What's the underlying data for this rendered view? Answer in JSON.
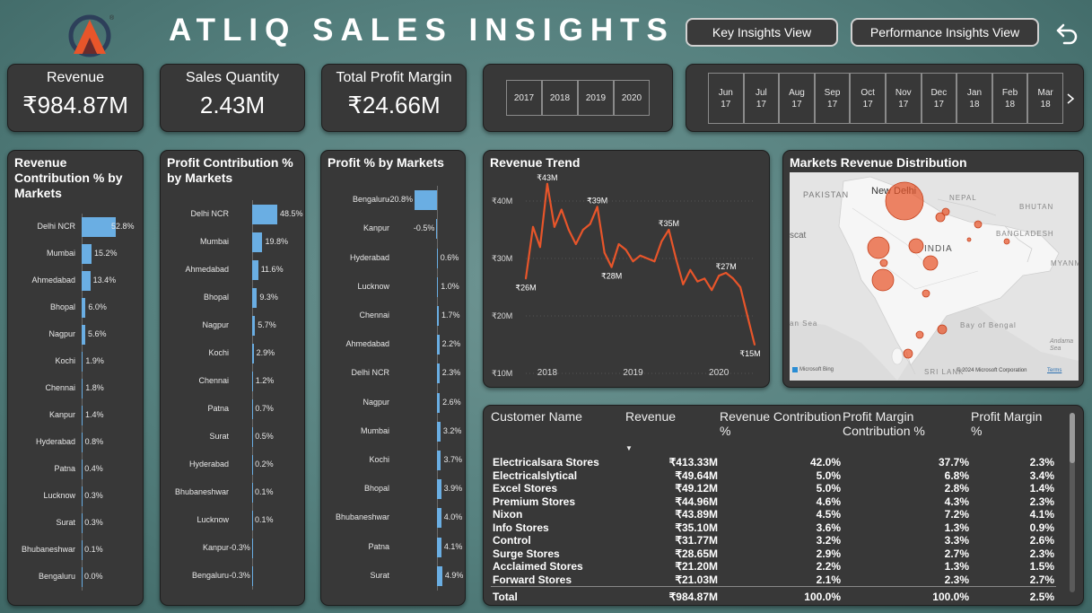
{
  "header": {
    "title": "ATLIQ SALES INSIGHTS",
    "nav_buttons": [
      "Key Insights View",
      "Performance Insights View"
    ]
  },
  "kpis": [
    {
      "label": "Revenue",
      "value": "₹984.87M"
    },
    {
      "label": "Sales Quantity",
      "value": "2.43M"
    },
    {
      "label": "Total Profit Margin",
      "value": "₹24.66M"
    }
  ],
  "year_slicer": [
    "2017",
    "2018",
    "2019",
    "2020"
  ],
  "month_slicer": [
    [
      "Jun",
      "17"
    ],
    [
      "Jul",
      "17"
    ],
    [
      "Aug",
      "17"
    ],
    [
      "Sep",
      "17"
    ],
    [
      "Oct",
      "17"
    ],
    [
      "Nov",
      "17"
    ],
    [
      "Dec",
      "17"
    ],
    [
      "Jan",
      "18"
    ],
    [
      "Feb",
      "18"
    ],
    [
      "Mar",
      "18"
    ]
  ],
  "revenue_contribution": {
    "title": "Revenue Contribution % by Markets",
    "items": [
      {
        "label": "Delhi NCR",
        "value": 52.8,
        "text": "52.8%"
      },
      {
        "label": "Mumbai",
        "value": 15.2,
        "text": "15.2%"
      },
      {
        "label": "Ahmedabad",
        "value": 13.4,
        "text": "13.4%"
      },
      {
        "label": "Bhopal",
        "value": 6.0,
        "text": "6.0%"
      },
      {
        "label": "Nagpur",
        "value": 5.6,
        "text": "5.6%"
      },
      {
        "label": "Kochi",
        "value": 1.9,
        "text": "1.9%"
      },
      {
        "label": "Chennai",
        "value": 1.8,
        "text": "1.8%"
      },
      {
        "label": "Kanpur",
        "value": 1.4,
        "text": "1.4%"
      },
      {
        "label": "Hyderabad",
        "value": 0.8,
        "text": "0.8%"
      },
      {
        "label": "Patna",
        "value": 0.4,
        "text": "0.4%"
      },
      {
        "label": "Lucknow",
        "value": 0.3,
        "text": "0.3%"
      },
      {
        "label": "Surat",
        "value": 0.3,
        "text": "0.3%"
      },
      {
        "label": "Bhubaneshwar",
        "value": 0.1,
        "text": "0.1%"
      },
      {
        "label": "Bengaluru",
        "value": 0.0,
        "text": "0.0%"
      }
    ]
  },
  "profit_contribution": {
    "title": "Profit Contribution % by Markets",
    "items": [
      {
        "label": "Delhi NCR",
        "value": 48.5,
        "text": "48.5%"
      },
      {
        "label": "Mumbai",
        "value": 19.8,
        "text": "19.8%"
      },
      {
        "label": "Ahmedabad",
        "value": 11.6,
        "text": "11.6%"
      },
      {
        "label": "Bhopal",
        "value": 9.3,
        "text": "9.3%"
      },
      {
        "label": "Nagpur",
        "value": 5.7,
        "text": "5.7%"
      },
      {
        "label": "Kochi",
        "value": 2.9,
        "text": "2.9%"
      },
      {
        "label": "Chennai",
        "value": 1.2,
        "text": "1.2%"
      },
      {
        "label": "Patna",
        "value": 0.7,
        "text": "0.7%"
      },
      {
        "label": "Surat",
        "value": 0.5,
        "text": "0.5%"
      },
      {
        "label": "Hyderabad",
        "value": 0.2,
        "text": "0.2%"
      },
      {
        "label": "Bhubaneshwar",
        "value": 0.1,
        "text": "0.1%"
      },
      {
        "label": "Lucknow",
        "value": 0.1,
        "text": "0.1%"
      },
      {
        "label": "Kanpur",
        "value": -0.3,
        "text": "-0.3%"
      },
      {
        "label": "Bengaluru",
        "value": -0.3,
        "text": "-0.3%"
      }
    ]
  },
  "profit_pct": {
    "title": "Profit % by Markets",
    "items": [
      {
        "label": "Bengaluru",
        "value": -20.8,
        "text": "-20.8%"
      },
      {
        "label": "Kanpur",
        "value": -0.5,
        "text": "-0.5%"
      },
      {
        "label": "Hyderabad",
        "value": 0.6,
        "text": "0.6%"
      },
      {
        "label": "Lucknow",
        "value": 1.0,
        "text": "1.0%"
      },
      {
        "label": "Chennai",
        "value": 1.7,
        "text": "1.7%"
      },
      {
        "label": "Ahmedabad",
        "value": 2.2,
        "text": "2.2%"
      },
      {
        "label": "Delhi NCR",
        "value": 2.3,
        "text": "2.3%"
      },
      {
        "label": "Nagpur",
        "value": 2.6,
        "text": "2.6%"
      },
      {
        "label": "Mumbai",
        "value": 3.2,
        "text": "3.2%"
      },
      {
        "label": "Kochi",
        "value": 3.7,
        "text": "3.7%"
      },
      {
        "label": "Bhopal",
        "value": 3.9,
        "text": "3.9%"
      },
      {
        "label": "Bhubaneshwar",
        "value": 4.0,
        "text": "4.0%"
      },
      {
        "label": "Patna",
        "value": 4.1,
        "text": "4.1%"
      },
      {
        "label": "Surat",
        "value": 4.9,
        "text": "4.9%"
      }
    ]
  },
  "chart_data": {
    "type": "line",
    "title": "Revenue Trend",
    "y_ticks": [
      "₹40M",
      "₹30M",
      "₹20M",
      "₹10M"
    ],
    "x_ticks": [
      "2018",
      "2019",
      "2020"
    ],
    "ylim": [
      10,
      45
    ],
    "color": "#e8552a",
    "x": [
      "2017-10",
      "2017-11",
      "2017-12",
      "2018-01",
      "2018-02",
      "2018-03",
      "2018-04",
      "2018-05",
      "2018-06",
      "2018-07",
      "2018-08",
      "2018-09",
      "2018-10",
      "2018-11",
      "2018-12",
      "2019-01",
      "2019-02",
      "2019-03",
      "2019-04",
      "2019-05",
      "2019-06",
      "2019-07",
      "2019-08",
      "2019-09",
      "2019-10",
      "2019-11",
      "2019-12",
      "2020-01",
      "2020-02",
      "2020-03",
      "2020-04",
      "2020-05",
      "2020-06"
    ],
    "values": [
      26.5,
      35.5,
      32,
      43,
      35.5,
      38.5,
      35,
      32.5,
      35,
      36,
      39,
      31,
      28.5,
      32.5,
      31.5,
      29.5,
      30.5,
      30,
      29.5,
      33,
      35,
      30,
      25.5,
      28,
      26,
      26.5,
      24.5,
      27,
      27.5,
      26.5,
      25,
      20,
      15
    ],
    "data_labels": [
      {
        "text": "₹26M",
        "index": 0
      },
      {
        "text": "₹43M",
        "index": 3
      },
      {
        "text": "₹39M",
        "index": 10
      },
      {
        "text": "₹28M",
        "index": 12
      },
      {
        "text": "₹35M",
        "index": 20
      },
      {
        "text": "₹27M",
        "index": 28
      },
      {
        "text": "₹15M",
        "index": 32
      }
    ]
  },
  "map": {
    "title": "Markets Revenue Distribution",
    "labels": [
      "PAKISTAN",
      "New Delhi",
      "NEPAL",
      "BHUTAN",
      "BANGLADESH",
      "INDIA",
      "MYANM",
      "scat",
      "an Sea",
      "Bay of Bengal",
      "Andama Sea",
      "SRI LANK"
    ],
    "attribution": "© 2024 Microsoft Corporation",
    "terms": "Terms",
    "bing": "Microsoft Bing"
  },
  "customer_table": {
    "headers": [
      "Customer Name",
      "Revenue",
      "Revenue Contribution %",
      "Profit Margin Contribution %",
      "Profit Margin %"
    ],
    "rows": [
      [
        "Electricalsara Stores",
        "₹413.33M",
        "42.0%",
        "37.7%",
        "2.3%"
      ],
      [
        "Electricalslytical",
        "₹49.64M",
        "5.0%",
        "6.8%",
        "3.4%"
      ],
      [
        "Excel Stores",
        "₹49.12M",
        "5.0%",
        "2.8%",
        "1.4%"
      ],
      [
        "Premium Stores",
        "₹44.96M",
        "4.6%",
        "4.3%",
        "2.3%"
      ],
      [
        "Nixon",
        "₹43.89M",
        "4.5%",
        "7.2%",
        "4.1%"
      ],
      [
        "Info Stores",
        "₹35.10M",
        "3.6%",
        "1.3%",
        "0.9%"
      ],
      [
        "Control",
        "₹31.77M",
        "3.2%",
        "3.3%",
        "2.6%"
      ],
      [
        "Surge Stores",
        "₹28.65M",
        "2.9%",
        "2.7%",
        "2.3%"
      ],
      [
        "Acclaimed Stores",
        "₹21.20M",
        "2.2%",
        "1.3%",
        "1.5%"
      ],
      [
        "Forward Stores",
        "₹21.03M",
        "2.1%",
        "2.3%",
        "2.7%"
      ]
    ],
    "total": [
      "Total",
      "₹984.87M",
      "100.0%",
      "100.0%",
      "2.5%"
    ]
  }
}
